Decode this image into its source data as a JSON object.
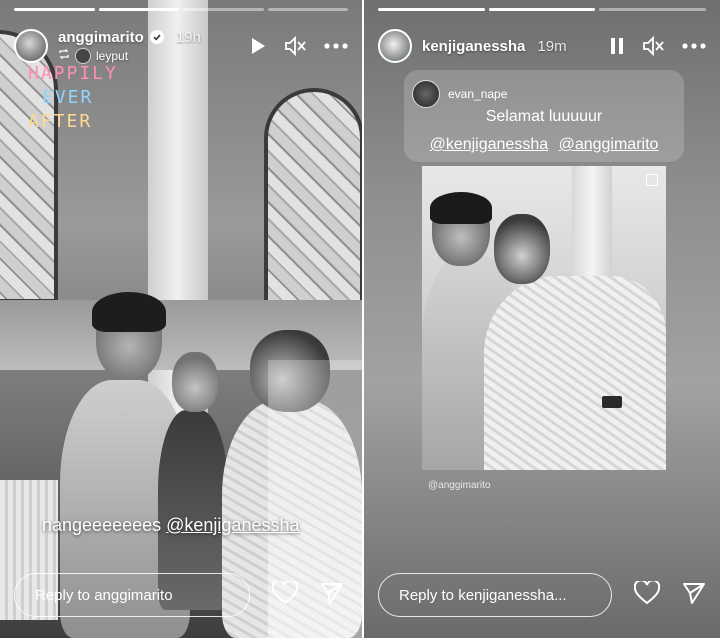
{
  "left_story": {
    "username": "anggimarito",
    "time": "19h",
    "repost_user": "leyput",
    "sticker_lines": [
      "HAPPILY",
      "EVER",
      "AFTER"
    ],
    "caption_prefix": "nangeeeeeees ",
    "caption_mention": "@kenjiganessha",
    "reply_placeholder": "Reply to anggimarito",
    "progress_done": 2,
    "progress_total": 4
  },
  "right_story": {
    "username": "kenjiganessha",
    "time": "19m",
    "shared_post_user": "evan_nape",
    "shared_message": "Selamat luuuuur",
    "shared_mentions": [
      "@kenjiganessha",
      "@anggimarito"
    ],
    "photo_credit": "@anggimarito",
    "reply_placeholder": "Reply to kenjiganessha...",
    "progress_done": 2,
    "progress_total": 3
  },
  "icons": {
    "play": "play-icon",
    "pause": "pause-icon",
    "mute": "speaker-muted-icon",
    "more": "more-icon",
    "like": "heart-icon",
    "share": "send-icon",
    "verified": "verified-badge-icon"
  }
}
